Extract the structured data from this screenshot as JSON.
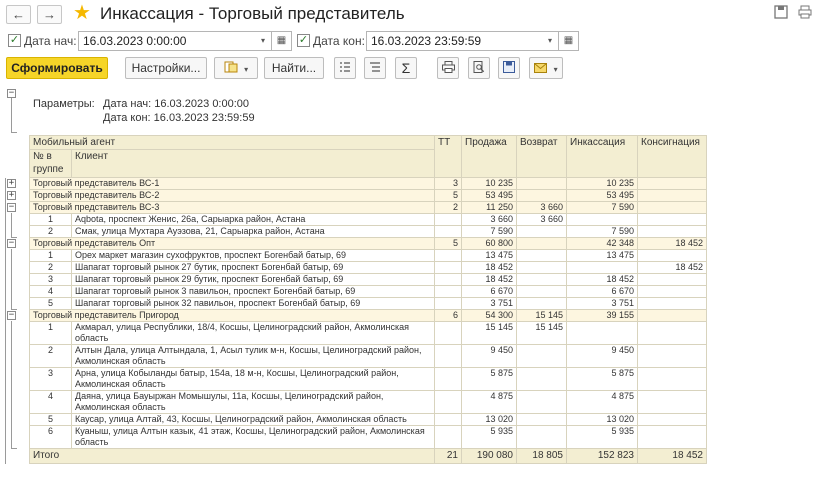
{
  "window": {
    "title": "Инкассация - Торговый представитель",
    "back_icon": "←",
    "forward_icon": "→"
  },
  "filters": {
    "date_from_label": "Дата нач:",
    "date_from_value": "16.03.2023  0:00:00",
    "date_from_checked": true,
    "date_to_label": "Дата кон:",
    "date_to_value": "16.03.2023 23:59:59",
    "date_to_checked": true
  },
  "toolbar": {
    "generate_label": "Сформировать",
    "settings_label": "Настройки...",
    "find_label": "Найти...",
    "sigma_label": "Σ"
  },
  "params": {
    "label": "Параметры:",
    "date_from": "Дата нач: 16.03.2023 0:00:00",
    "date_to": "Дата кон: 16.03.2023 23:59:59"
  },
  "table": {
    "headers": {
      "agent": "Мобильный агент",
      "tt": "ТТ",
      "sale": "Продажа",
      "return": "Возврат",
      "collection": "Инкассация",
      "consignment": "Консигнация",
      "group_no": "№ в группе",
      "client": "Клиент"
    },
    "groups": [
      {
        "name": "Торговый представитель ВС-1",
        "tt": "3",
        "sale": "10 235",
        "return": "",
        "collection": "10 235",
        "consignment": "",
        "expanded": false,
        "rows": []
      },
      {
        "name": "Торговый представитель ВС-2",
        "tt": "5",
        "sale": "53 495",
        "return": "",
        "collection": "53 495",
        "consignment": "",
        "expanded": false,
        "rows": []
      },
      {
        "name": "Торговый представитель ВС-3",
        "tt": "2",
        "sale": "11 250",
        "return": "3 660",
        "collection": "7 590",
        "consignment": "",
        "expanded": true,
        "rows": [
          {
            "n": "1",
            "client": "Aqbota, проспект Женис, 26а, Сарыарка район, Астана",
            "sale": "3 660",
            "return": "3 660",
            "collection": "",
            "consignment": ""
          },
          {
            "n": "2",
            "client": "Смак, улица Мухтара Ауэзова, 21, Сарыарка район, Астана",
            "sale": "7 590",
            "return": "",
            "collection": "7 590",
            "consignment": ""
          }
        ]
      },
      {
        "name": "Торговый представитель Опт",
        "tt": "5",
        "sale": "60 800",
        "return": "",
        "collection": "42 348",
        "consignment": "18 452",
        "expanded": true,
        "rows": [
          {
            "n": "1",
            "client": "Орех маркет магазин сухофруктов, проспект Богенбай батыр, 69",
            "sale": "13 475",
            "return": "",
            "collection": "13 475",
            "consignment": ""
          },
          {
            "n": "2",
            "client": "Шапагат торговый рынок 27 бутик, проспект Богенбай батыр, 69",
            "sale": "18 452",
            "return": "",
            "collection": "",
            "consignment": "18 452"
          },
          {
            "n": "3",
            "client": "Шапагат торговый рынок 29 бутик, проспект Богенбай батыр, 69",
            "sale": "18 452",
            "return": "",
            "collection": "18 452",
            "consignment": ""
          },
          {
            "n": "4",
            "client": "Шапагат торговый рынок 3 павильон, проспект Богенбай батыр, 69",
            "sale": "6 670",
            "return": "",
            "collection": "6 670",
            "consignment": ""
          },
          {
            "n": "5",
            "client": "Шапагат торговый рынок 32 павильон, проспект Богенбай батыр, 69",
            "sale": "3 751",
            "return": "",
            "collection": "3 751",
            "consignment": ""
          }
        ]
      },
      {
        "name": "Торговый представитель Пригород",
        "tt": "6",
        "sale": "54 300",
        "return": "15 145",
        "collection": "39 155",
        "consignment": "",
        "expanded": true,
        "rows": [
          {
            "n": "1",
            "client": "Акмарал, улица Республики, 18/4, Косшы, Целиноградский район, Акмолинская область",
            "sale": "15 145",
            "return": "15 145",
            "collection": "",
            "consignment": ""
          },
          {
            "n": "2",
            "client": "Алтын Дала, улица Алтындала, 1, Асыл тулик м-н, Косшы, Целиноградский район, Акмолинская область",
            "sale": "9 450",
            "return": "",
            "collection": "9 450",
            "consignment": ""
          },
          {
            "n": "3",
            "client": "Арна, улица Кобыланды батыр, 154а, 18 м-н, Косшы, Целиноградский район, Акмолинская область",
            "sale": "5 875",
            "return": "",
            "collection": "5 875",
            "consignment": ""
          },
          {
            "n": "4",
            "client": "Даяна, улица Бауыржан Момышулы, 11а, Косшы, Целиноградский район, Акмолинская область",
            "sale": "4 875",
            "return": "",
            "collection": "4 875",
            "consignment": ""
          },
          {
            "n": "5",
            "client": "Каусар, улица Алтай, 43, Косшы, Целиноградский район, Акмолинская область",
            "sale": "13 020",
            "return": "",
            "collection": "13 020",
            "consignment": ""
          },
          {
            "n": "6",
            "client": "Куаныш, улица Алтын казык, 41 этаж, Косшы, Целиноградский район, Акмолинская область",
            "sale": "5 935",
            "return": "",
            "collection": "5 935",
            "consignment": ""
          }
        ]
      }
    ],
    "total": {
      "label": "Итого",
      "tt": "21",
      "sale": "190 080",
      "return": "18 805",
      "collection": "152 823",
      "consignment": "18 452"
    }
  }
}
